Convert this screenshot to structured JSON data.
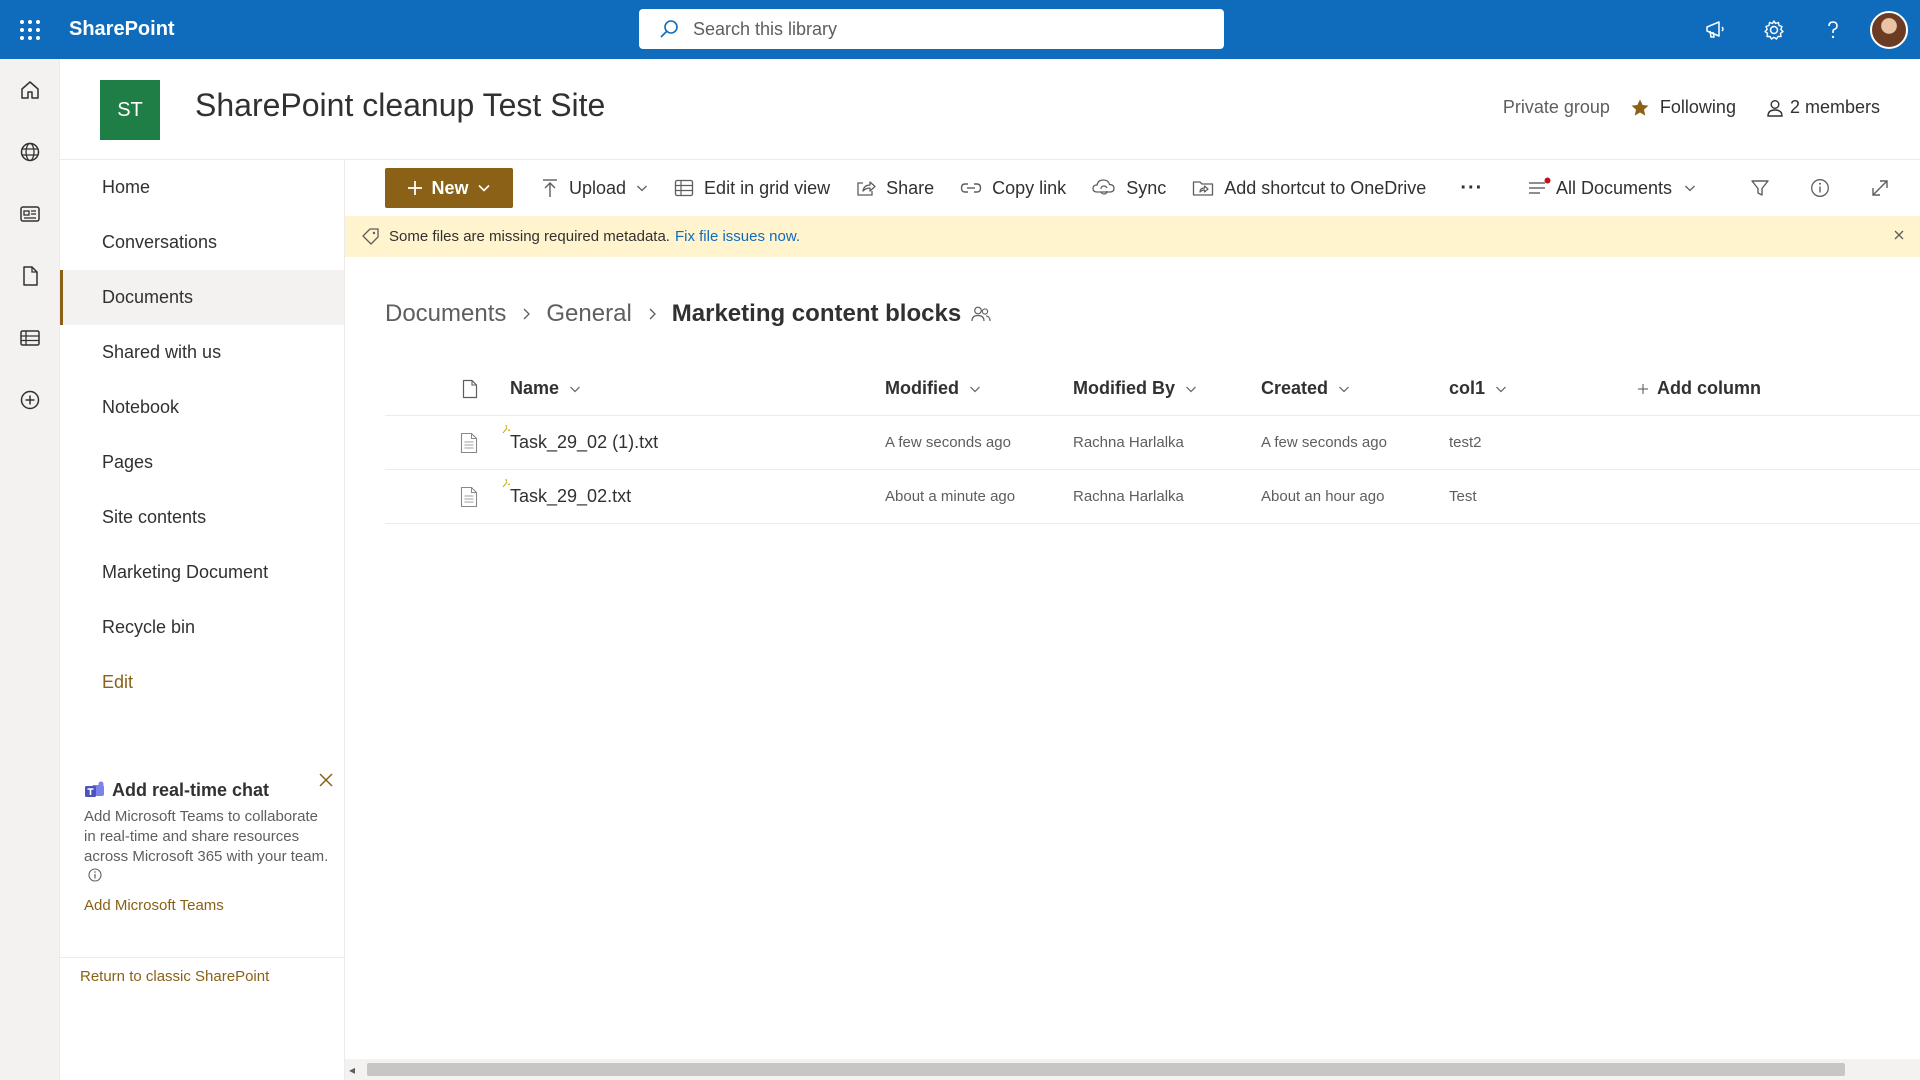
{
  "suite": {
    "app_name": "SharePoint",
    "search_placeholder": "Search this library",
    "icons": [
      "waffle-icon",
      "megaphone-icon",
      "gear-icon",
      "help-icon",
      "avatar"
    ]
  },
  "appbar": {
    "items": [
      "home-icon",
      "globe-icon",
      "news-icon",
      "document-icon",
      "list-icon",
      "create-icon"
    ]
  },
  "site": {
    "logo_initials": "ST",
    "logo_color": "#1e7e45",
    "title": "SharePoint cleanup Test Site",
    "privacy": "Private group",
    "follow_label": "Following",
    "members_label": "2 members"
  },
  "nav": {
    "items": [
      {
        "label": "Home"
      },
      {
        "label": "Conversations"
      },
      {
        "label": "Documents",
        "selected": true
      },
      {
        "label": "Shared with us"
      },
      {
        "label": "Notebook"
      },
      {
        "label": "Pages"
      },
      {
        "label": "Site contents"
      },
      {
        "label": "Marketing Document"
      },
      {
        "label": "Recycle bin"
      }
    ],
    "edit_label": "Edit",
    "chat_card": {
      "title": "Add real-time chat",
      "body": "Add Microsoft Teams to collaborate in real-time and share resources across Microsoft 365 with your team.",
      "link": "Add Microsoft Teams"
    },
    "classic_link": "Return to classic SharePoint"
  },
  "commandbar": {
    "new_label": "New",
    "upload_label": "Upload",
    "grid_label": "Edit in grid view",
    "share_label": "Share",
    "copy_link_label": "Copy link",
    "sync_label": "Sync",
    "shortcut_label": "Add shortcut to OneDrive",
    "more_label": "···",
    "view_label": "All Documents"
  },
  "banner": {
    "message": "Some files are missing required metadata.",
    "link": "Fix file issues now."
  },
  "breadcrumb": {
    "items": [
      "Documents",
      "General",
      "Marketing content blocks"
    ]
  },
  "columns": {
    "name": "Name",
    "modified": "Modified",
    "modified_by": "Modified By",
    "created": "Created",
    "col1": "col1",
    "add_column": "Add column"
  },
  "rows": [
    {
      "name": "Task_29_02 (1).txt",
      "modified": "A few seconds ago",
      "modified_by": "Rachna Harlalka",
      "created": "A few seconds ago",
      "col1": "test2"
    },
    {
      "name": "Task_29_02.txt",
      "modified": "About a minute ago",
      "modified_by": "Rachna Harlalka",
      "created": "About an hour ago",
      "col1": "Test"
    }
  ],
  "colors": {
    "suite_bar": "#0f6cbd",
    "accent": "#8a6116",
    "banner_bg": "#fff4ce",
    "link": "#0f6cbd"
  }
}
